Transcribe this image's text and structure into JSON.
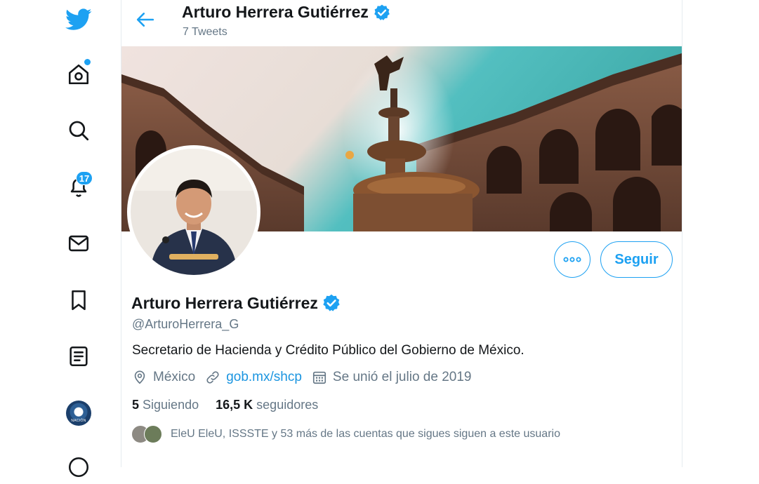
{
  "sidebar": {
    "icons": [
      "twitter-logo-icon",
      "home-icon",
      "explore-icon",
      "notifications-icon",
      "messages-icon",
      "bookmarks-icon",
      "lists-icon",
      "profile-avatar",
      "more-icon"
    ],
    "notifications_count": "17"
  },
  "header": {
    "name": "Arturo Herrera Gutiérrez",
    "tweets_count": "7 Tweets"
  },
  "profile": {
    "name": "Arturo Herrera Gutiérrez",
    "handle": "@ArturoHerrera_G",
    "bio": "Secretario de Hacienda y Crédito Público del Gobierno de México.",
    "location": "México",
    "website": "gob.mx/shcp",
    "joined": "Se unió el julio de 2019",
    "following_count": "5",
    "following_label": "Siguiendo",
    "followers_count": "16,5 K",
    "followers_label": "seguidores",
    "followed_by": "EleU EleU, ISSSTE y 53 más de las cuentas que sigues siguen a este usuario"
  },
  "actions": {
    "follow_label": "Seguir"
  },
  "colors": {
    "accent": "#1da1f2",
    "text": "#14171a",
    "secondary": "#657786",
    "link": "#1b95e0"
  }
}
